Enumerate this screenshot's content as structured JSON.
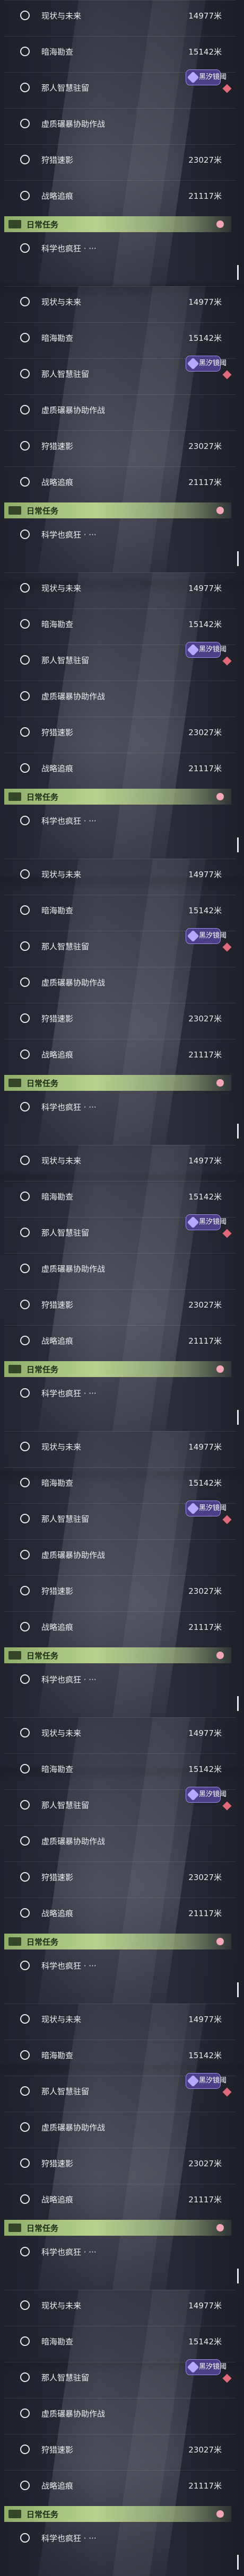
{
  "tasks": [
    {
      "name": "现状与未来",
      "distance": "14977米",
      "tag": "",
      "alert": false
    },
    {
      "name": "暗海勘查",
      "distance": "15142米",
      "tag": "",
      "alert": false
    },
    {
      "name": "那人智慧驻留",
      "distance": "",
      "tag": "黑汐镜阈",
      "alert": true
    },
    {
      "name": "虚质碾暴协助作战",
      "distance": "",
      "tag": "",
      "alert": false
    },
    {
      "name": "狩猎速影",
      "distance": "23027米",
      "tag": "",
      "alert": false
    },
    {
      "name": "战略追痕",
      "distance": "21117米",
      "tag": "",
      "alert": false
    }
  ],
  "daily": {
    "label": "日常任务"
  },
  "daily_tasks": [
    {
      "name": "科学也疯狂 · ···"
    }
  ],
  "panel_count": 9
}
